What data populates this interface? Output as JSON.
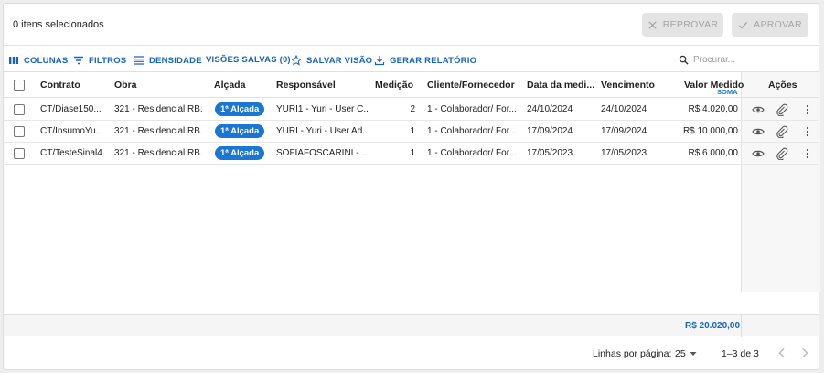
{
  "header": {
    "selected_count": "0 itens selecionados",
    "reprovar_label": "REPROVAR",
    "aprovar_label": "APROVAR"
  },
  "toolbar": {
    "colunas": "COLUNAS",
    "filtros": "FILTROS",
    "densidade": "DENSIDADE",
    "visoes_salvas": "VISÕES SALVAS (0)",
    "salvar_visao": "SALVAR VISÃO",
    "gerar_relatorio": "GERAR RELATÓRIO",
    "search_placeholder": "Procurar..."
  },
  "columns": {
    "contrato": "Contrato",
    "obra": "Obra",
    "alcada": "Alçada",
    "responsavel": "Responsável",
    "medicao": "Medição",
    "cliente": "Cliente/Fornecedor",
    "data": "Data da medi...",
    "vencimento": "Vencimento",
    "valor": "Valor Medido",
    "soma": "SOMA",
    "acoes": "Ações"
  },
  "rows": [
    {
      "contrato": "CT/Diase150...",
      "obra": "321 - Residencial RB...",
      "alcada": "1ª Alçada",
      "responsavel": "YURI1 - Yuri - User C...",
      "medicao": "2",
      "cliente": "1 - Colaborador/ For...",
      "data": "24/10/2024",
      "vencimento": "24/10/2024",
      "valor": "R$ 4.020,00"
    },
    {
      "contrato": "CT/InsumoYu...",
      "obra": "321 - Residencial RB...",
      "alcada": "1ª Alçada",
      "responsavel": "YURI - Yuri - User Ad...",
      "medicao": "1",
      "cliente": "1 - Colaborador/ For...",
      "data": "17/09/2024",
      "vencimento": "17/09/2024",
      "valor": "R$ 10.000,00"
    },
    {
      "contrato": "CT/TesteSinal4",
      "obra": "321 - Residencial RB...",
      "alcada": "1ª Alçada",
      "responsavel": "SOFIAFOSCARINI - ...",
      "medicao": "1",
      "cliente": "1 - Colaborador/ For...",
      "data": "17/05/2023",
      "vencimento": "17/05/2023",
      "valor": "R$ 6.000,00"
    }
  ],
  "footer": {
    "total": "R$ 20.020,00",
    "rows_per_page_label": "Linhas por página:",
    "rows_per_page_value": "25",
    "range": "1–3 de 3"
  },
  "colors": {
    "accent": "#1565c0",
    "badge": "#1976d2",
    "disabled_bg": "#e4e4e4",
    "disabled_text": "#a5a5a5"
  }
}
